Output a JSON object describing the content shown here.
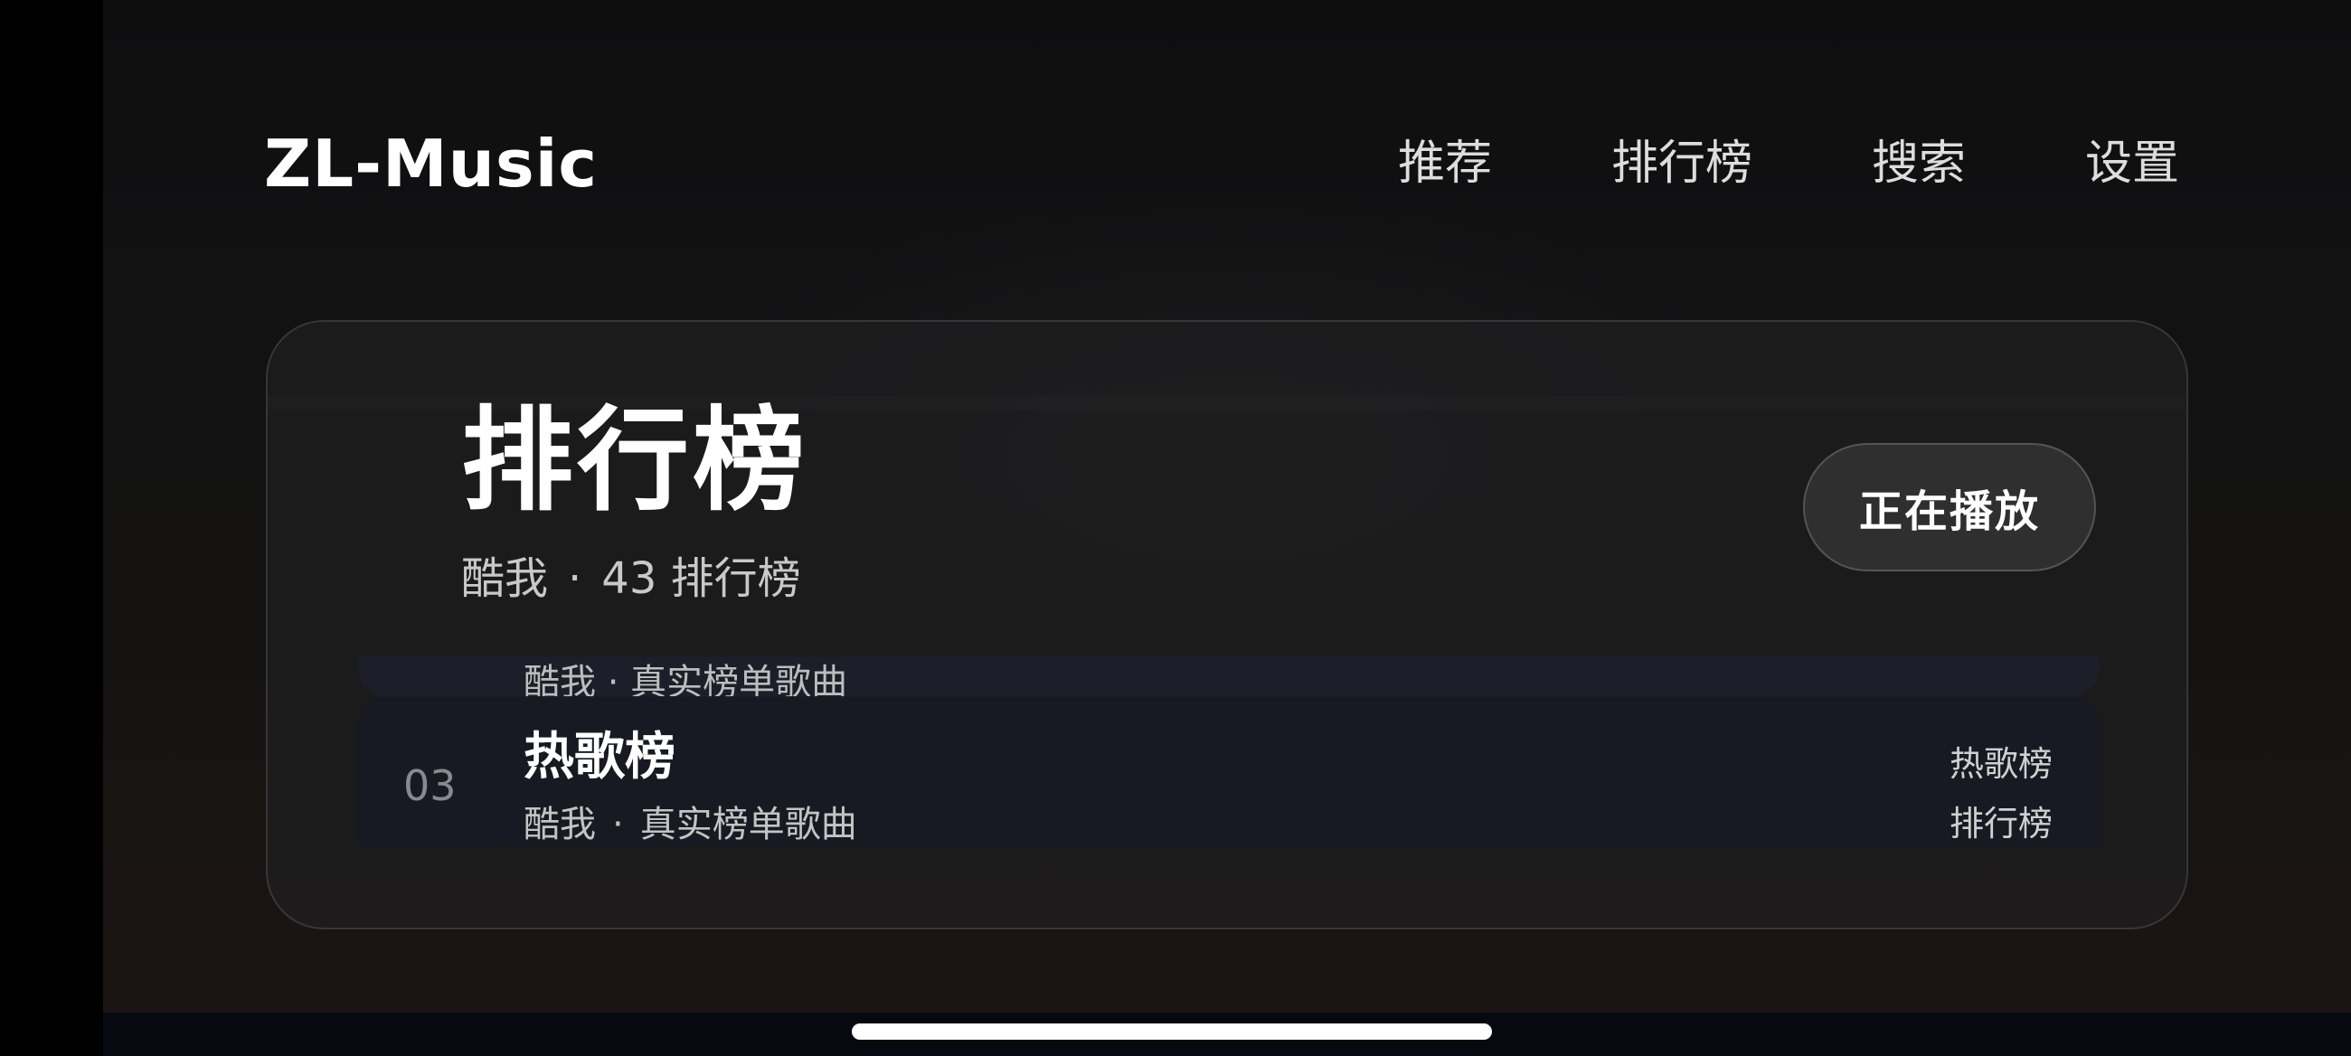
{
  "app": {
    "title": "ZL-Music"
  },
  "nav": {
    "items": [
      {
        "label": "推荐"
      },
      {
        "label": "排行榜"
      },
      {
        "label": "搜索"
      },
      {
        "label": "设置"
      }
    ]
  },
  "panel": {
    "title": "排行榜",
    "subtitle": {
      "source": "酷我",
      "separator": "·",
      "count": "43 排行榜"
    },
    "now_playing_label": "正在播放"
  },
  "list": {
    "peek_row": {
      "meta": "酷我 · 真实榜单歌曲"
    },
    "rows": [
      {
        "index": "03",
        "title": "热歌榜",
        "source": "酷我",
        "separator": "·",
        "description": "真实榜单歌曲",
        "tag1": "热歌榜",
        "tag2": "排行榜"
      }
    ]
  },
  "colors": {
    "background": "#121213",
    "panel": "#1e1e20",
    "row": "#181a24",
    "text_primary": "#ffffff",
    "text_secondary": "#c4c4c4",
    "index": "#8a8a8e"
  }
}
